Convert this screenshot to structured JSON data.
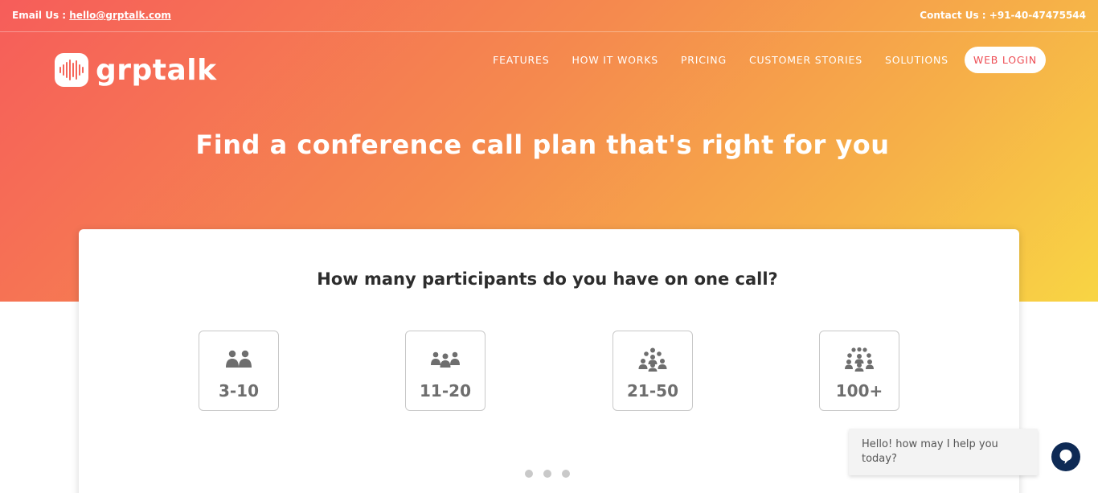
{
  "topbar": {
    "email_label": "Email Us :",
    "email": "hello@grptalk.com",
    "contact": "Contact Us : +91-40-47475544"
  },
  "logo": {
    "text": "grptalk"
  },
  "nav": {
    "items": [
      "FEATURES",
      "HOW IT WORKS",
      "PRICING",
      "CUSTOMER STORIES",
      "SOLUTIONS"
    ],
    "login": "WEB LOGIN"
  },
  "hero": {
    "headline": "Find a conference call plan that's right for you"
  },
  "card": {
    "question": "How many participants do you have on one call?",
    "options": [
      {
        "label": "3-10",
        "icon": "two-people-icon"
      },
      {
        "label": "11-20",
        "icon": "three-people-icon"
      },
      {
        "label": "21-50",
        "icon": "group-people-icon"
      },
      {
        "label": "100+",
        "icon": "crowd-people-icon"
      }
    ]
  },
  "chat": {
    "message": "Hello! how may I help you today?"
  },
  "colors": {
    "gradient_start": "#f65d5a",
    "gradient_end": "#f8d544",
    "login_text": "#ee4f56",
    "chat_button": "#0e2a55"
  }
}
